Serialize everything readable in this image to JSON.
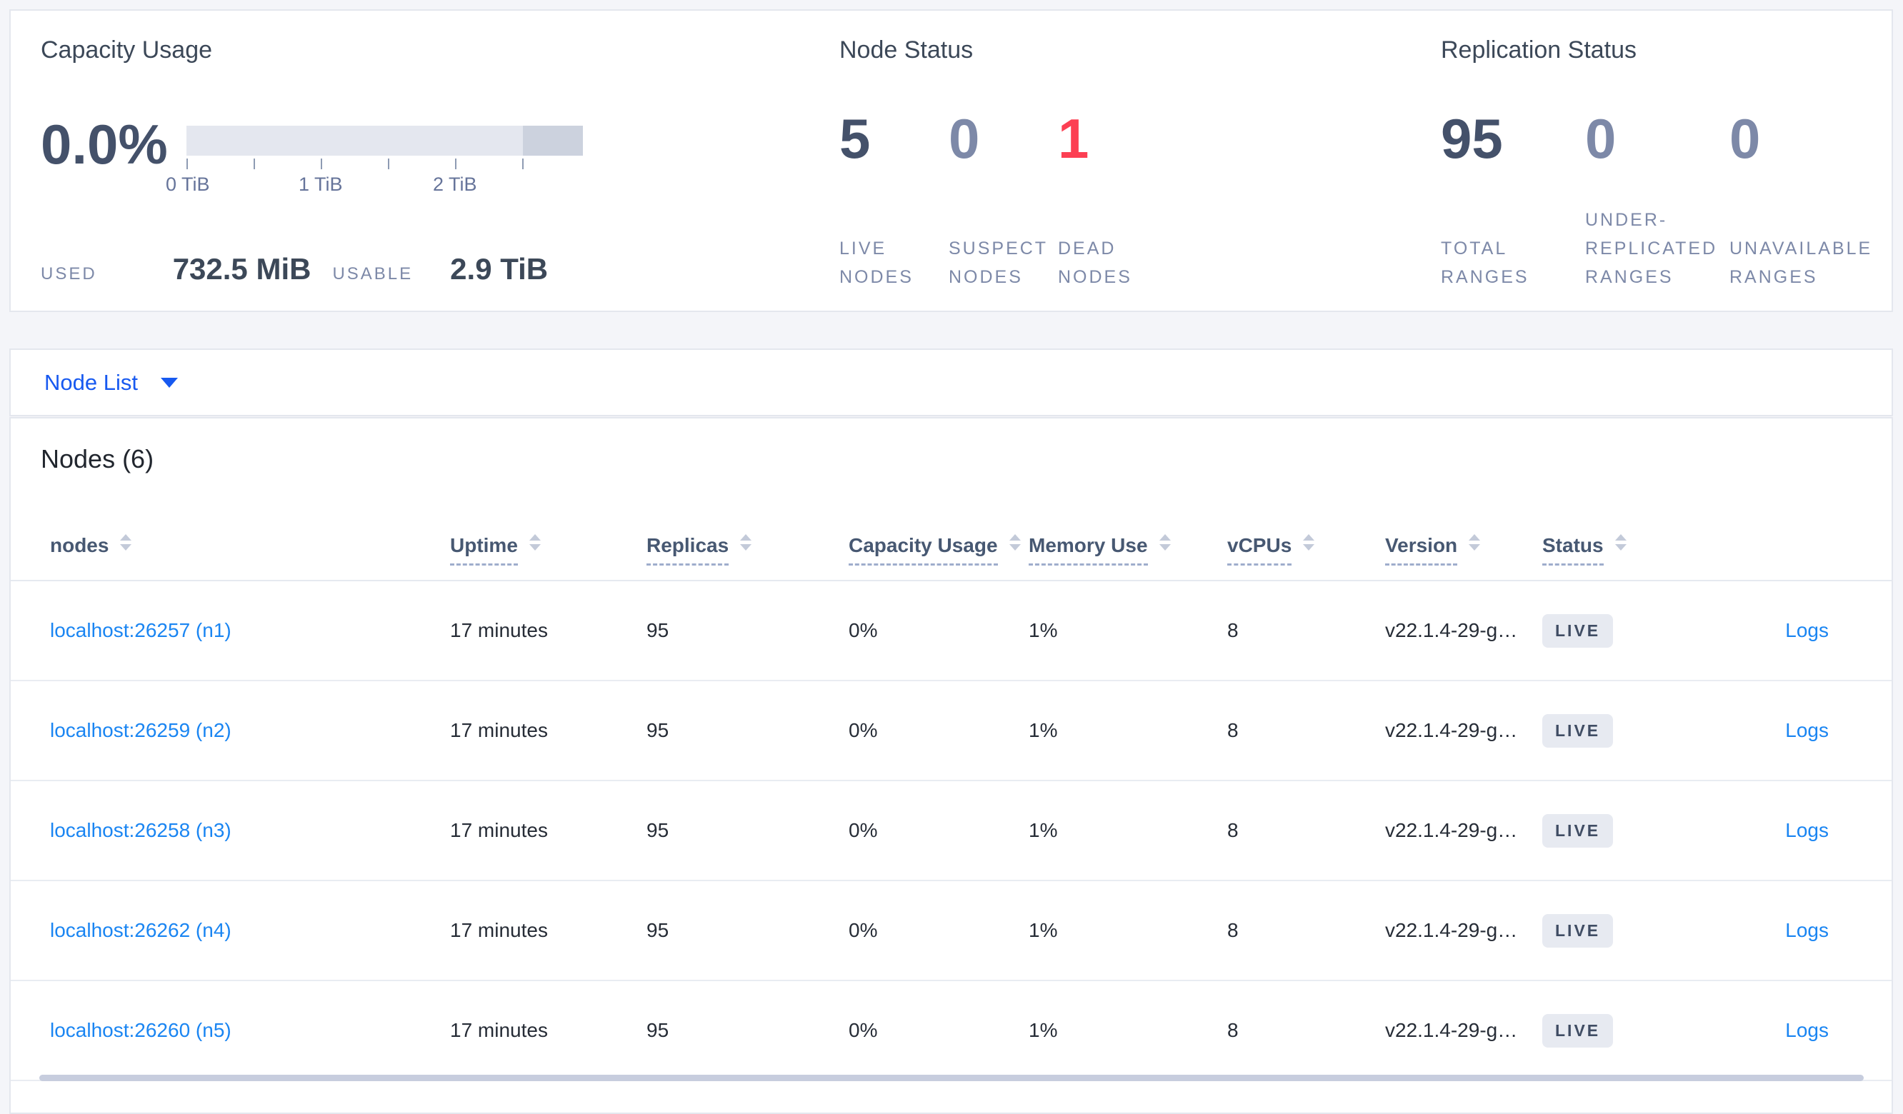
{
  "summary": {
    "capacity": {
      "title": "Capacity Usage",
      "percent": "0.0%",
      "ticks": [
        "0 TiB",
        "1 TiB",
        "2 TiB"
      ],
      "used_label": "USED",
      "used_value": "732.5 MiB",
      "usable_label": "USABLE",
      "usable_value": "2.9 TiB"
    },
    "node_status": {
      "title": "Node Status",
      "stats": [
        {
          "value": "5",
          "label": "LIVE NODES"
        },
        {
          "value": "0",
          "label": "SUSPECT NODES"
        },
        {
          "value": "1",
          "label": "DEAD NODES"
        }
      ]
    },
    "replication_status": {
      "title": "Replication Status",
      "stats": [
        {
          "value": "95",
          "label": "TOTAL RANGES"
        },
        {
          "value": "0",
          "label": "UNDER-REPLICATED RANGES"
        },
        {
          "value": "0",
          "label": "UNAVAILABLE RANGES"
        }
      ]
    }
  },
  "view_selector": {
    "label": "Node List"
  },
  "nodes_table": {
    "title": "Nodes (6)",
    "columns": [
      "nodes",
      "Uptime",
      "Replicas",
      "Capacity Usage",
      "Memory Use",
      "vCPUs",
      "Version",
      "Status"
    ],
    "rows": [
      {
        "address": "localhost:26257 (n1)",
        "uptime": "17 minutes",
        "replicas": "95",
        "capacity": "0%",
        "memory": "1%",
        "vcpus": "8",
        "version": "v22.1.4-29-g…",
        "status": "LIVE",
        "logs": "Logs"
      },
      {
        "address": "localhost:26259 (n2)",
        "uptime": "17 minutes",
        "replicas": "95",
        "capacity": "0%",
        "memory": "1%",
        "vcpus": "8",
        "version": "v22.1.4-29-g…",
        "status": "LIVE",
        "logs": "Logs"
      },
      {
        "address": "localhost:26258 (n3)",
        "uptime": "17 minutes",
        "replicas": "95",
        "capacity": "0%",
        "memory": "1%",
        "vcpus": "8",
        "version": "v22.1.4-29-g…",
        "status": "LIVE",
        "logs": "Logs"
      },
      {
        "address": "localhost:26262 (n4)",
        "uptime": "17 minutes",
        "replicas": "95",
        "capacity": "0%",
        "memory": "1%",
        "vcpus": "8",
        "version": "v22.1.4-29-g…",
        "status": "LIVE",
        "logs": "Logs"
      },
      {
        "address": "localhost:26260 (n5)",
        "uptime": "17 minutes",
        "replicas": "95",
        "capacity": "0%",
        "memory": "1%",
        "vcpus": "8",
        "version": "v22.1.4-29-g…",
        "status": "LIVE",
        "logs": "Logs"
      }
    ]
  },
  "colors": {
    "accent_blue": "#1759f0",
    "link_blue": "#1a85f2",
    "danger_red": "#fc3f53",
    "dark_slate": "#44516a",
    "muted_slate": "#7d89a8"
  }
}
